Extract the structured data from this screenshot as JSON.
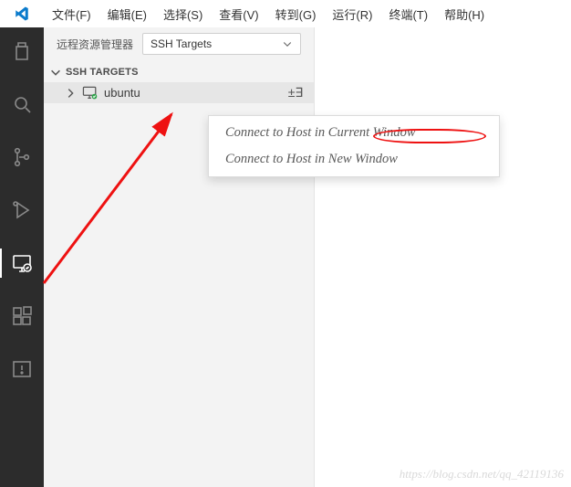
{
  "menu": {
    "file": "文件(F)",
    "edit": "编辑(E)",
    "select": "选择(S)",
    "view": "查看(V)",
    "goto": "转到(G)",
    "run": "运行(R)",
    "terminal": "终端(T)",
    "help": "帮助(H)"
  },
  "panel": {
    "header_label": "远程资源管理器",
    "dropdown_value": "SSH Targets",
    "section_title": "SSH TARGETS",
    "host_label": "ubuntu",
    "row_action_glyph": "±∃"
  },
  "context_menu": {
    "item0": "Connect to Host in Current Window",
    "item1": "Connect to Host in New Window"
  },
  "watermark": "https://blog.csdn.net/qq_42119136"
}
